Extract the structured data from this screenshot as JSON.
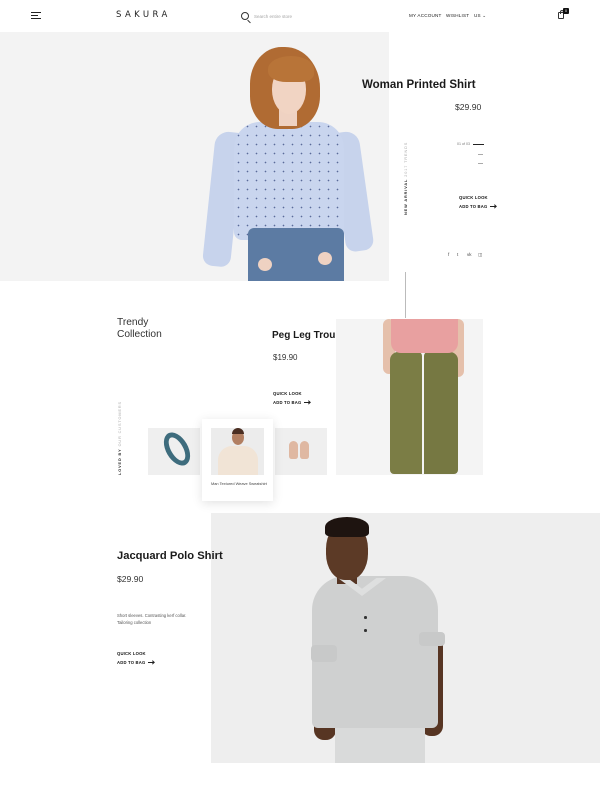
{
  "header": {
    "logo": "SAKURA",
    "search_placeholder": "Search entire store",
    "nav": {
      "account": "MY ACCOUNT",
      "wishlist": "WISHLIST",
      "language": "US ⌄"
    },
    "cart_count": "0"
  },
  "hero": {
    "title": "Woman Printed Shirt",
    "price": "$29.90",
    "vertical_label": {
      "bold": "NEW ARRIVAL",
      "grey": "2017 TRENDS"
    },
    "slide_counter": "01 of 03",
    "quick_look": "QUICK LOOK",
    "add_to_bag": "ADD TO BAG",
    "social": [
      "f",
      "t",
      "vk",
      "◫"
    ]
  },
  "trendy": {
    "title_line1": "Trendy",
    "title_line2": "Collection",
    "vertical_label": {
      "bold": "LOVED BY",
      "grey": "OUR CUSTOMERS"
    },
    "product_title": "Peg Leg Troursers",
    "product_price": "$19.90",
    "quick_look": "QUICK LOOK",
    "add_to_bag": "ADD TO BAG",
    "card_label": "Man Textured Weave Sweatshirt"
  },
  "polo": {
    "title": "Jacquard Polo Shirt",
    "price": "$29.90",
    "description": "Short sleeves. Contrasting kerf collar. Tailoring collection",
    "quick_look": "QUICK LOOK",
    "add_to_bag": "ADD TO BAG"
  },
  "colors": {
    "text": "#1a1a1a",
    "background": "#ffffff",
    "panel": "#f3f3f3"
  }
}
